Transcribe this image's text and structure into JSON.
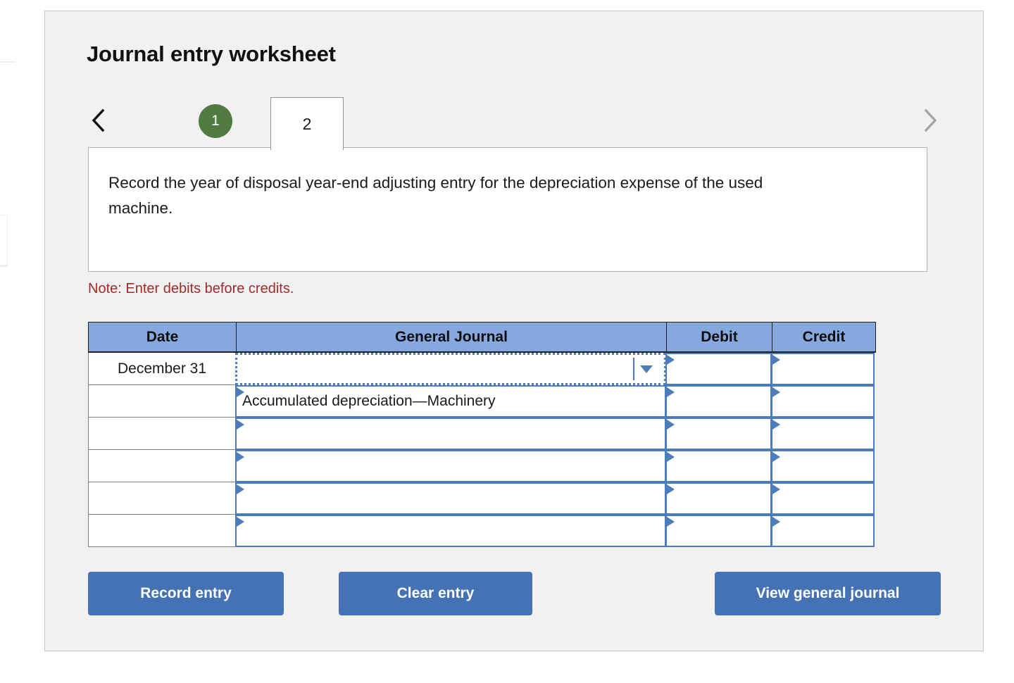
{
  "panel": {
    "title": "Journal entry worksheet"
  },
  "tabs": {
    "prev_icon": "chevron-left-icon",
    "next_icon": "chevron-right-icon",
    "items": [
      {
        "label": "1",
        "state": "completed"
      },
      {
        "label": "2",
        "state": "active"
      }
    ]
  },
  "prompt": {
    "text": "Record the year of disposal year-end adjusting entry for the depreciation expense of the used machine."
  },
  "note": {
    "text": "Note: Enter debits before credits."
  },
  "table": {
    "columns": [
      "Date",
      "General Journal",
      "Debit",
      "Credit"
    ],
    "rows": [
      {
        "date": "December 31",
        "general_journal": "",
        "debit": "",
        "credit": "",
        "focused": true,
        "has_dropdown": true
      },
      {
        "date": "",
        "general_journal": "Accumulated depreciation—Machinery",
        "debit": "",
        "credit": "",
        "focused": false,
        "has_dropdown": false
      },
      {
        "date": "",
        "general_journal": "",
        "debit": "",
        "credit": "",
        "focused": false,
        "has_dropdown": false
      },
      {
        "date": "",
        "general_journal": "",
        "debit": "",
        "credit": "",
        "focused": false,
        "has_dropdown": false
      },
      {
        "date": "",
        "general_journal": "",
        "debit": "",
        "credit": "",
        "focused": false,
        "has_dropdown": false
      },
      {
        "date": "",
        "general_journal": "",
        "debit": "",
        "credit": "",
        "focused": false,
        "has_dropdown": false
      }
    ]
  },
  "buttons": {
    "record": "Record entry",
    "clear": "Clear entry",
    "view": "View general journal"
  },
  "colors": {
    "panel_bg": "#f1f1f1",
    "header_blue": "#85a9de",
    "button_blue": "#4472b4",
    "field_blue": "#4d7cbd",
    "tab_green": "#4f7a40",
    "note_red": "#a52a2a"
  }
}
